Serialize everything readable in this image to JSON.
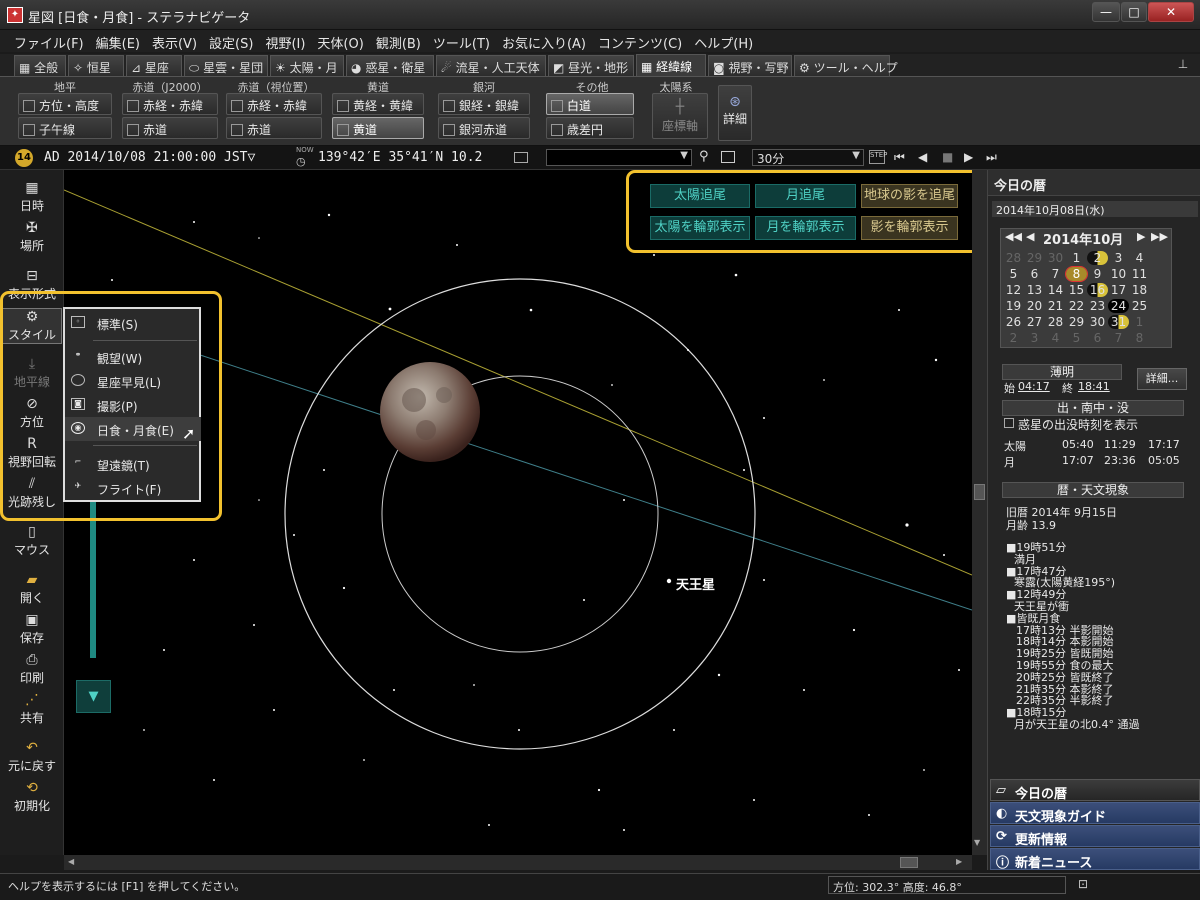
{
  "window": {
    "title": "星図 [日食・月食] - ステラナビゲータ",
    "btn_min": "—",
    "btn_max": "□",
    "btn_close": "✕"
  },
  "menu": [
    "ファイル(F)",
    "編集(E)",
    "表示(V)",
    "設定(S)",
    "視野(I)",
    "天体(O)",
    "観測(B)",
    "ツール(T)",
    "お気に入り(A)",
    "コンテンツ(C)",
    "ヘルプ(H)"
  ],
  "tabs": [
    "全般",
    "恒星",
    "星座",
    "星雲・星団",
    "太陽・月",
    "惑星・衛星",
    "流星・人工天体",
    "昼光・地形",
    "経緯線",
    "視野・写野",
    "ツール・ヘルプ"
  ],
  "ribbon": {
    "groups": [
      "地平",
      "赤道（J2000）",
      "赤道（視位置）",
      "黄道",
      "銀河",
      "その他",
      "太陽系"
    ],
    "buttons": [
      "方位・高度",
      "子午線",
      "赤経・赤緯",
      "赤道",
      "赤経・赤緯",
      "赤道",
      "黄経・黄緯",
      "黄道",
      "銀経・銀緯",
      "銀河赤道",
      "白道",
      "歳差円"
    ],
    "coord_axis": "座標軸",
    "detail": "詳細"
  },
  "infobar": {
    "badge": "14",
    "datetime": "AD 2014/10/08 21:00:00 JST▽",
    "location": "139°42′E 35°41′N 10.2",
    "step": "30分",
    "now": "NOW"
  },
  "sidebar": [
    "日時",
    "場所",
    "表示形式",
    "スタイル",
    "地平線",
    "方位",
    "視野回転",
    "光跡残し",
    "マウス",
    "開く",
    "保存",
    "印刷",
    "共有",
    "元に戻す",
    "初期化"
  ],
  "style_menu": {
    "items": [
      "標準(S)",
      "観望(W)",
      "星座早見(L)",
      "撮影(P)",
      "日食・月食(E)",
      "望遠鏡(T)",
      "フライト(F)"
    ]
  },
  "track_buttons": [
    "太陽追尾",
    "月追尾",
    "地球の影を追尾",
    "太陽を輪郭表示",
    "月を輪郭表示",
    "影を輪郭表示"
  ],
  "sky": {
    "planet_label": "天王星"
  },
  "calendar": {
    "panel_title": "今日の暦",
    "date": "2014年10月08日(水)",
    "month": "2014年10月",
    "nav_prev2": "◀◀",
    "nav_prev": "◀",
    "nav_next": "▶",
    "nav_next2": "▶▶",
    "weeks": [
      [
        "28",
        "29",
        "30",
        "1",
        "2",
        "3",
        "4"
      ],
      [
        "5",
        "6",
        "7",
        "8",
        "9",
        "10",
        "11"
      ],
      [
        "12",
        "13",
        "14",
        "15",
        "16",
        "17",
        "18"
      ],
      [
        "19",
        "20",
        "21",
        "22",
        "23",
        "24",
        "25"
      ],
      [
        "26",
        "27",
        "28",
        "29",
        "30",
        "31",
        "1"
      ],
      [
        "2",
        "3",
        "4",
        "5",
        "6",
        "7",
        "8"
      ]
    ]
  },
  "twilight": {
    "header": "薄明",
    "start_label": "始",
    "start": "04:17",
    "end_label": "終",
    "end": "18:41",
    "detail_btn": "詳細..."
  },
  "rise": {
    "header": "出・南中・没",
    "checkbox": "惑星の出没時刻を表示",
    "rows": [
      [
        "太陽",
        "05:40",
        "11:29",
        "17:17"
      ],
      [
        "月",
        "17:07",
        "23:36",
        "05:05"
      ]
    ]
  },
  "events": {
    "header": "暦・天文現象",
    "lunar_date": "旧暦 2014年 9月15日",
    "moon_age": "月齢 13.9",
    "lines": [
      "■19時51分",
      "満月",
      "■17時47分",
      "寒露(太陽黄経195°)",
      "■12時49分",
      "天王星が衝",
      "■皆既月食",
      "17時13分 半影開始",
      "18時14分 本影開始",
      "19時25分 皆既開始",
      "19時55分 食の最大",
      "20時25分 皆既終了",
      "21時35分 本影終了",
      "22時35分 半影終了",
      "■18時15分",
      "月が天王星の北0.4° 通過"
    ]
  },
  "nav": [
    "今日の暦",
    "天文現象ガイド",
    "更新情報",
    "新着ニュース"
  ],
  "status": {
    "help": "ヘルプを表示するには [F1] を押してください。",
    "direction": "方位: 302.3° 高度: 46.8°"
  }
}
